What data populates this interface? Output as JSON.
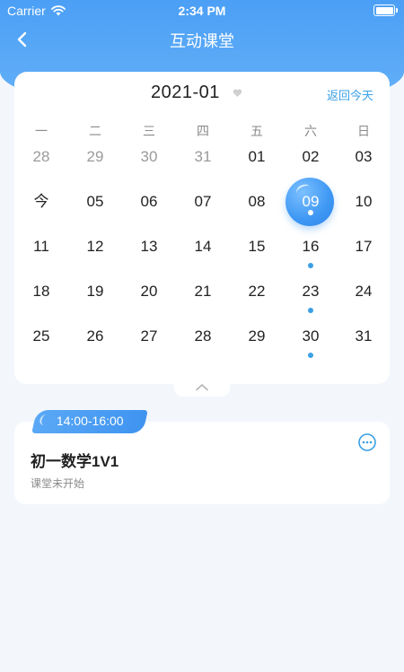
{
  "status_bar": {
    "carrier": "Carrier",
    "time": "2:34 PM"
  },
  "nav": {
    "title": "互动课堂"
  },
  "calendar": {
    "month": "2021-01",
    "today_button": "返回今天",
    "weekdays": [
      "一",
      "二",
      "三",
      "四",
      "五",
      "六",
      "日"
    ],
    "weeks": [
      [
        {
          "d": "28",
          "muted": true
        },
        {
          "d": "29",
          "muted": true
        },
        {
          "d": "30",
          "muted": true
        },
        {
          "d": "31",
          "muted": true
        },
        {
          "d": "01"
        },
        {
          "d": "02"
        },
        {
          "d": "03"
        }
      ],
      [
        {
          "d": "今"
        },
        {
          "d": "05"
        },
        {
          "d": "06"
        },
        {
          "d": "07"
        },
        {
          "d": "08"
        },
        {
          "d": "09",
          "selected": true,
          "dot": true
        },
        {
          "d": "10"
        }
      ],
      [
        {
          "d": "11"
        },
        {
          "d": "12"
        },
        {
          "d": "13"
        },
        {
          "d": "14"
        },
        {
          "d": "15"
        },
        {
          "d": "16",
          "dot": true
        },
        {
          "d": "17"
        }
      ],
      [
        {
          "d": "18"
        },
        {
          "d": "19"
        },
        {
          "d": "20"
        },
        {
          "d": "21"
        },
        {
          "d": "22"
        },
        {
          "d": "23",
          "dot": true
        },
        {
          "d": "24"
        }
      ],
      [
        {
          "d": "25"
        },
        {
          "d": "26"
        },
        {
          "d": "27"
        },
        {
          "d": "28"
        },
        {
          "d": "29"
        },
        {
          "d": "30",
          "dot": true
        },
        {
          "d": "31"
        }
      ]
    ],
    "accent": "#3aa0e6"
  },
  "lesson": {
    "time": "14:00-16:00",
    "title": "初一数学1V1",
    "status": "课堂未开始"
  }
}
